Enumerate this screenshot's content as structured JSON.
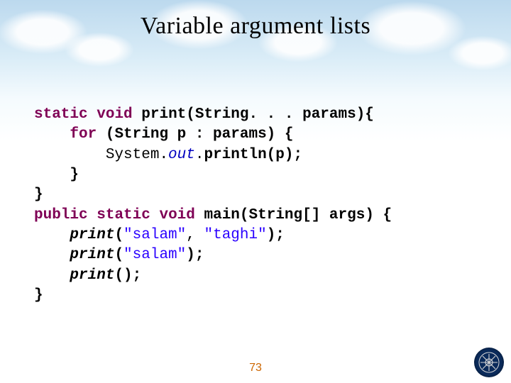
{
  "title": "Variable argument lists",
  "code": {
    "l1": {
      "kw1": "static",
      "kw2": "void",
      "rest": " print(String. . . params){"
    },
    "l2": {
      "indent": "    ",
      "kw": "for",
      "rest": " (String p : params) {"
    },
    "l3": {
      "indent": "        ",
      "sys": "System.",
      "field": "out",
      "rest1": ".",
      "rest2": "println(p);"
    },
    "l4": {
      "indent": "    ",
      "text": "}"
    },
    "l5": {
      "text": "}"
    },
    "l6": {
      "kw1": "public",
      "kw2": "static",
      "kw3": "void",
      "rest": " main(String[] args) {"
    },
    "l7": {
      "indent": "    ",
      "call": "print",
      "p1": "(",
      "s1": "\"salam\"",
      "c": ",",
      "sp": " ",
      "s2": "\"taghi\"",
      "p2": ");"
    },
    "l8": {
      "indent": "    ",
      "call": "print",
      "p1": "(",
      "s1": "\"salam\"",
      "p2": ");"
    },
    "l9": {
      "indent": "    ",
      "call": "print",
      "rest": "();"
    },
    "l10": {
      "text": "}"
    }
  },
  "page_number": "73",
  "logo_name": "sharif-university-logo"
}
